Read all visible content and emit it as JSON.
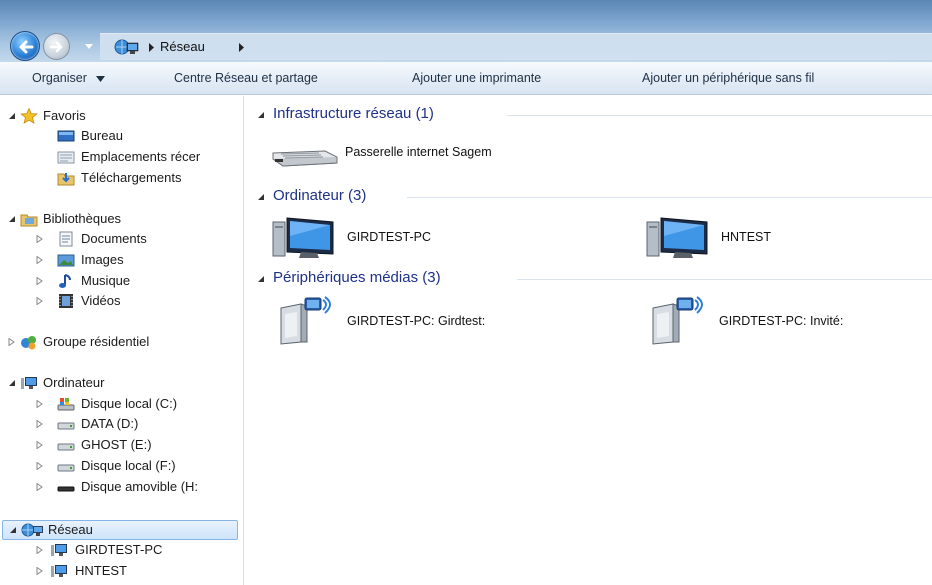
{
  "address_bar": {
    "path": [
      "Réseau"
    ]
  },
  "toolbar": {
    "organize_label": "Organiser",
    "network_center_label": "Centre Réseau et partage",
    "add_printer_label": "Ajouter une imprimante",
    "add_wireless_label": "Ajouter un périphérique sans fil"
  },
  "nav": {
    "favorites": {
      "label": "Favoris",
      "items": [
        {
          "label": "Bureau",
          "icon": "desktop-icon"
        },
        {
          "label": "Emplacements récer",
          "icon": "recent-places-icon"
        },
        {
          "label": "Téléchargements",
          "icon": "downloads-icon"
        }
      ]
    },
    "libraries": {
      "label": "Bibliothèques",
      "items": [
        {
          "label": "Documents",
          "icon": "documents-icon"
        },
        {
          "label": "Images",
          "icon": "images-icon"
        },
        {
          "label": "Musique",
          "icon": "music-icon"
        },
        {
          "label": "Vidéos",
          "icon": "videos-icon"
        }
      ]
    },
    "homegroup": {
      "label": "Groupe résidentiel"
    },
    "computer": {
      "label": "Ordinateur",
      "items": [
        {
          "label": "Disque local (C:)",
          "icon": "system-drive-icon"
        },
        {
          "label": "DATA (D:)",
          "icon": "drive-icon"
        },
        {
          "label": "GHOST (E:)",
          "icon": "drive-icon"
        },
        {
          "label": "Disque local (F:)",
          "icon": "drive-icon"
        },
        {
          "label": "Disque amovible (H:",
          "icon": "removable-drive-icon"
        }
      ]
    },
    "network": {
      "label": "Réseau",
      "items": [
        {
          "label": "GIRDTEST-PC",
          "icon": "computer-icon"
        },
        {
          "label": "HNTEST",
          "icon": "computer-icon"
        }
      ]
    }
  },
  "content": {
    "groups": [
      {
        "title": "Infrastructure réseau (1)",
        "devices": [
          {
            "label": "Passerelle internet Sagem",
            "icon": "router-icon"
          }
        ]
      },
      {
        "title": "Ordinateur (3)",
        "devices": [
          {
            "label": "GIRDTEST-PC",
            "icon": "computer-icon"
          },
          {
            "label": "HNTEST",
            "icon": "computer-icon"
          }
        ]
      },
      {
        "title": "Périphériques médias (3)",
        "devices": [
          {
            "label": "GIRDTEST-PC: Girdtest:",
            "icon": "media-device-icon"
          },
          {
            "label": "GIRDTEST-PC: Invité:",
            "icon": "media-device-icon"
          }
        ]
      }
    ]
  },
  "colors": {
    "group_header": "#1e3287",
    "selection_bg": "#cfe4fa",
    "selection_border": "#86b6e8"
  }
}
